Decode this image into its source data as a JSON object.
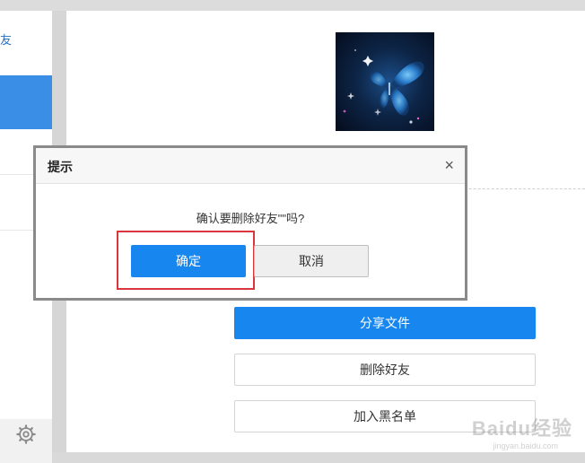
{
  "sidebar": {
    "item_label_partial": "友",
    "settings_icon": "gear-icon"
  },
  "profile": {
    "avatar_icon": "butterfly-avatar"
  },
  "actions": {
    "share_label": "分享文件",
    "delete_label": "删除好友",
    "block_label": "加入黑名单"
  },
  "dialog": {
    "title": "提示",
    "close_label": "×",
    "message": "确认要删除好友\"\"吗?",
    "confirm_label": "确定",
    "cancel_label": "取消"
  },
  "watermark": {
    "text": "Baidu经验",
    "sub": "jingyan.baidu.com"
  },
  "colors": {
    "accent": "#1787ef",
    "sidebar_selected": "#3a8ee6",
    "highlight": "#d9363e"
  }
}
